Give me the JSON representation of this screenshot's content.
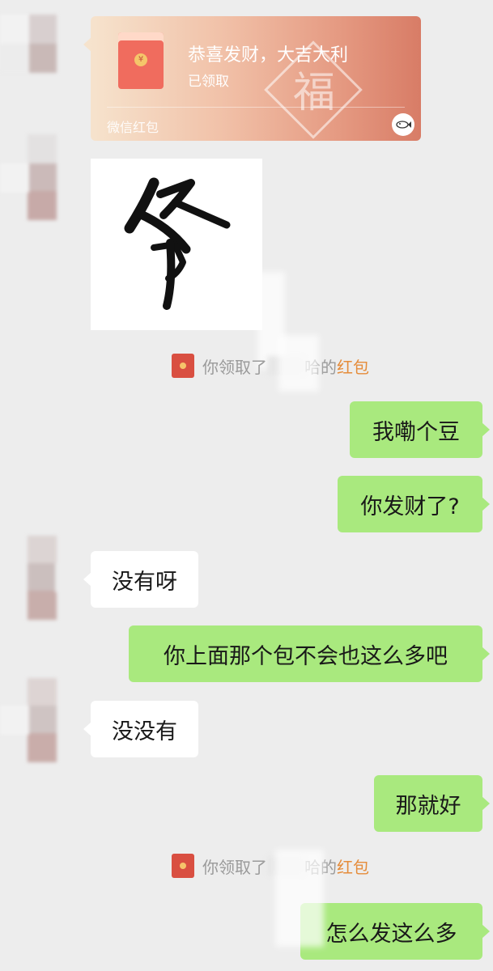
{
  "red_packet": {
    "title": "恭喜发财，大吉大利",
    "status": "已领取",
    "brand": "微信红包",
    "fu_char": "福",
    "coin_symbol": "¥",
    "fish_icon": "fish-icon"
  },
  "sticker": {
    "character": "爷"
  },
  "notices": [
    {
      "prefix": "你领取了",
      "suffix": "哈的",
      "link": "红包"
    },
    {
      "prefix": "你领取了",
      "suffix": "哈的",
      "link": "红包"
    }
  ],
  "messages": [
    {
      "side": "me",
      "text": "我嘞个豆"
    },
    {
      "side": "me",
      "text": "你发财了?"
    },
    {
      "side": "them",
      "text": "没有呀"
    },
    {
      "side": "me",
      "text": "你上面那个包不会也这么多吧"
    },
    {
      "side": "them",
      "text": "没没有"
    },
    {
      "side": "me",
      "text": "那就好"
    },
    {
      "side": "me",
      "text": "怎么发这么多"
    }
  ],
  "colors": {
    "background": "#ededed",
    "my_bubble": "#a9e97e",
    "their_bubble": "#ffffff",
    "notice_text": "#9a9a9a",
    "notice_link": "#e58c3a",
    "red_packet_icon": "#d94f41"
  }
}
